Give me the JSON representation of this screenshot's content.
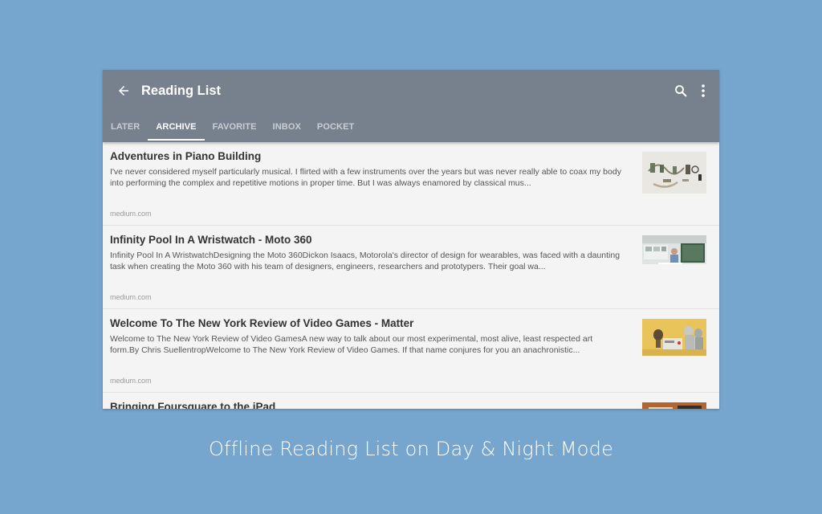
{
  "colors": {
    "background": "#76a5cd",
    "appbar": "#77818d",
    "list_background": "#f4f4f4",
    "tab_active": "#ffffff",
    "tab_inactive": "#c9ced3"
  },
  "appbar": {
    "title": "Reading List",
    "back_icon": "arrow-left-icon",
    "search_icon": "search-icon",
    "more_icon": "more-vert-icon"
  },
  "tabs": [
    {
      "label": "LATER",
      "active": false
    },
    {
      "label": "ARCHIVE",
      "active": true
    },
    {
      "label": "FAVORITE",
      "active": false
    },
    {
      "label": "INBOX",
      "active": false
    },
    {
      "label": "POCKET",
      "active": false
    }
  ],
  "articles": [
    {
      "title": "Adventures in Piano Building",
      "excerpt": "I've never considered myself particularly musical. I flirted with a few instruments over the years but was never really able to coax my body into performing the complex and repetitive motions in proper time. But I was always enamored by classical mus...",
      "source": "medium.com",
      "thumbnail": "piano-parts-photo"
    },
    {
      "title": "Infinity Pool In A Wristwatch - Moto 360",
      "excerpt": "Infinity Pool In A WristwatchDesigning the Moto 360Dickon Isaacs, Motorola's director of design for wearables, was faced with a daunting task when creating the Moto 360 with his team of designers, engineers, researchers and prototypers. Their goal wa...",
      "source": "medium.com",
      "thumbnail": "design-studio-photo"
    },
    {
      "title": "Welcome To The New York Review of Video Games - Matter",
      "excerpt": "Welcome to The New York Review of Video GamesA new way to talk about our most experimental, most alive, least respected art form.By Chris SuellentropWelcome to The New York Review of Video Games. If that name conjures for you an anachronistic...",
      "source": "medium.com",
      "thumbnail": "retro-console-illustration"
    },
    {
      "title": "Bringing Foursquare to the iPad",
      "excerpt": "",
      "source": "",
      "thumbnail": "ipad-photo"
    }
  ],
  "caption": "Offline Reading List on Day & Night Mode"
}
